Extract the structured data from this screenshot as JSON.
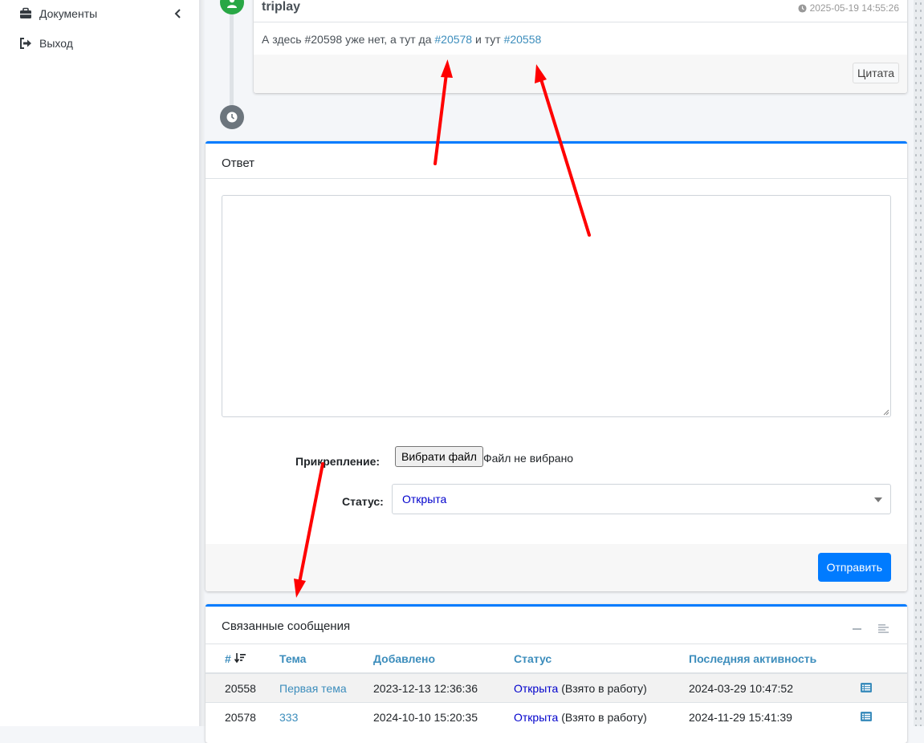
{
  "sidebar": {
    "items": [
      {
        "label": "Документы",
        "icon": "briefcase-icon",
        "has_submenu": true
      },
      {
        "label": "Выход",
        "icon": "sign-out-icon"
      }
    ]
  },
  "message": {
    "author": "triplay",
    "timestamp": "2025-05-19 14:55:26",
    "body": {
      "prefix": "А здесь #20598 уже нет, а тут да ",
      "link1": "#20578",
      "middle": " и тут ",
      "link2": "#20558"
    },
    "quote_button": "Цитата"
  },
  "reply": {
    "title": "Ответ",
    "textarea_value": "",
    "attachment_label": "Прикрепление:",
    "file_button": "Вибрати файл",
    "file_status": "Файл не вибрано",
    "status_label": "Статус:",
    "status_value": "Открыта",
    "submit_button": "Отправить"
  },
  "related": {
    "title": "Связанные сообщения",
    "columns": [
      "#",
      "Тема",
      "Добавлено",
      "Статус",
      "Последняя активность"
    ],
    "rows": [
      {
        "id": "20558",
        "topic": "Первая тема",
        "added": "2023-12-13 12:36:36",
        "status": "Открыта",
        "status_note": " (Взято в работу)",
        "last_activity": "2024-03-29 10:47:52"
      },
      {
        "id": "20578",
        "topic": "333",
        "added": "2024-10-10 15:20:35",
        "status": "Открыта",
        "status_note": " (Взято в работу)",
        "last_activity": "2024-11-29 15:41:39"
      }
    ]
  },
  "colors": {
    "primary": "#007bff",
    "link": "#3c8dbc",
    "status_open": "#0000cc",
    "arrow": "#ff0000",
    "avatar_green": "#28a745"
  }
}
